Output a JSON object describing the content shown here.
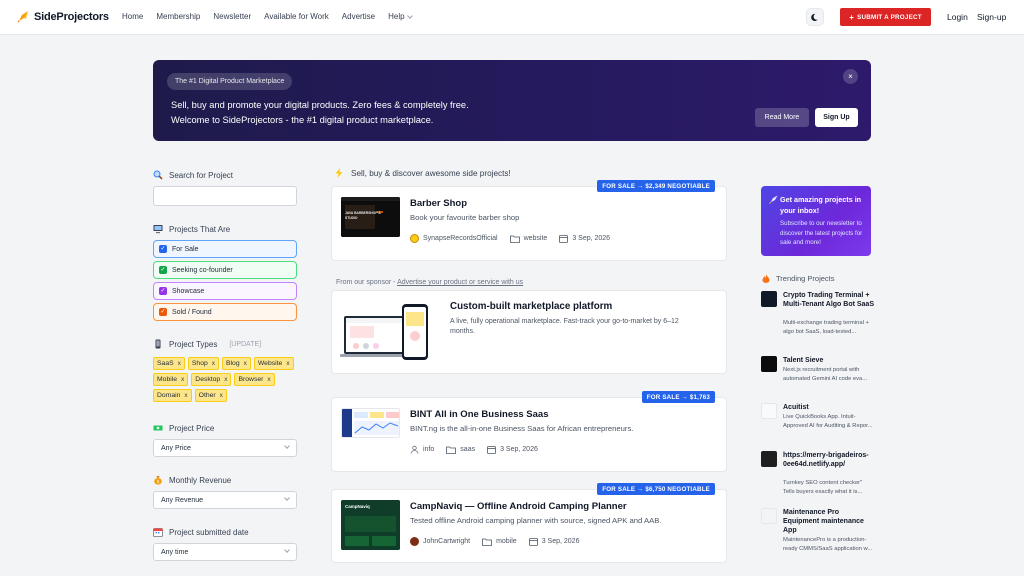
{
  "header": {
    "logo_text": "SideProjectors",
    "nav": [
      "Home",
      "Membership",
      "Newsletter",
      "Available for Work",
      "Advertise"
    ],
    "help_label": "Help",
    "submit_label": "SUBMIT A PROJECT",
    "login_label": "Login",
    "signup_label": "Sign-up",
    "accent": "#dc2626"
  },
  "banner": {
    "pill": "The #1 Digital Product Marketplace",
    "line1": "Sell, buy and promote your digital products. Zero fees & completely free.",
    "line2": "Welcome to SideProjectors - the #1 digital product marketplace.",
    "close": "×",
    "read_more": "Read More",
    "sign_up": "Sign Up"
  },
  "sidebar": {
    "search_title": "Search for Project",
    "search_placeholder": "",
    "status_title": "Projects That Are",
    "statuses": [
      {
        "label": "For Sale",
        "color": "#2563eb",
        "bg": "#eff6ff",
        "border": "#60a5fa"
      },
      {
        "label": "Seeking co-founder",
        "color": "#16a34a",
        "bg": "#f0fdf4",
        "border": "#4ade80"
      },
      {
        "label": "Showcase",
        "color": "#9333ea",
        "bg": "#faf5ff",
        "border": "#c084fc"
      },
      {
        "label": "Sold / Found",
        "color": "#ea580c",
        "bg": "#fff7ed",
        "border": "#fb923c"
      }
    ],
    "types_title": "Project Types",
    "types_update": "[UPDATE]",
    "types": [
      "SaaS",
      "Shop",
      "Blog",
      "Website",
      "Mobile",
      "Desktop",
      "Browser",
      "Domain",
      "Other"
    ],
    "type_remove": "x",
    "price_title": "Project Price",
    "price_value": "Any Price",
    "revenue_title": "Monthly Revenue",
    "revenue_value": "Any Revenue",
    "date_title": "Project submitted date",
    "date_value": "Any time"
  },
  "feed": {
    "heading": "Sell, buy & discover awesome side projects!",
    "sponsor_prefix": "From our sponsor - ",
    "sponsor_link": "Advertise your product or service with us",
    "sponsor": {
      "title": "Custom-built marketplace platform",
      "desc_line1": "A live, fully operational marketplace. Fast-track your go-to-market by 6–12",
      "desc_line2": "months."
    },
    "projects": [
      {
        "badge": "FOR SALE → $2,349 NEGOTIABLE",
        "title": "Barber Shop",
        "desc": "Book your favourite barber shop",
        "user": "SynapseRecordsOfficial",
        "category": "website",
        "date": "3 Sep, 2026",
        "thumb_text": "JAVA BARBERSHOP & STUDIO"
      },
      {
        "badge": "FOR SALE → $1,763",
        "title": "BINT All in One Business Saas",
        "desc": "BINT.ng is the all-in-one Business Saas for African entrepreneurs.",
        "user": "info",
        "category": "saas",
        "date": "3 Sep, 2026",
        "thumb_text": ""
      },
      {
        "badge": "FOR SALE → $6,750 NEGOTIABLE",
        "title": "CampNaviq — Offline Android Camping Planner",
        "desc": "Tested offline Android camping planner with source, signed APK and AAB.",
        "user": "JohnCartwright",
        "category": "mobile",
        "date": "3 Sep, 2026",
        "thumb_text": "CampNaviq"
      }
    ]
  },
  "right": {
    "promo_title": "Get amazing projects in your inbox!",
    "promo_text": "Subscribe to our newsletter to discover the latest projects for sale and more!",
    "trending_title": "Trending Projects",
    "trending": [
      {
        "title": "Crypto Trading Terminal + Multi-Tenant Algo Bot SaaS",
        "desc": "Multi-exchange trading terminal + algo bot SaaS, load-tested...",
        "thumb": "#111827"
      },
      {
        "title": "Talent Sieve",
        "desc": "Next.js recruitment portal with automated Gemini AI code eva...",
        "thumb": "#0b0b0b"
      },
      {
        "title": "Acuitist",
        "desc": "Live QuickBooks App. Intuit-Approved AI for Auditing & Repor...",
        "thumb": "#e5e7eb"
      },
      {
        "title": "https://merry-brigadeiros-0ee64d.netlify.app/",
        "desc": "Turnkey SEO content checker\" Tells buyers exactly what it is...",
        "thumb": "#1f1f1f"
      },
      {
        "title": "Maintenance Pro Equipment maintenance App",
        "desc": "MaintenancePro is a production-ready CMMS/SaaS application w...",
        "thumb": "#f3f4f6"
      }
    ]
  }
}
